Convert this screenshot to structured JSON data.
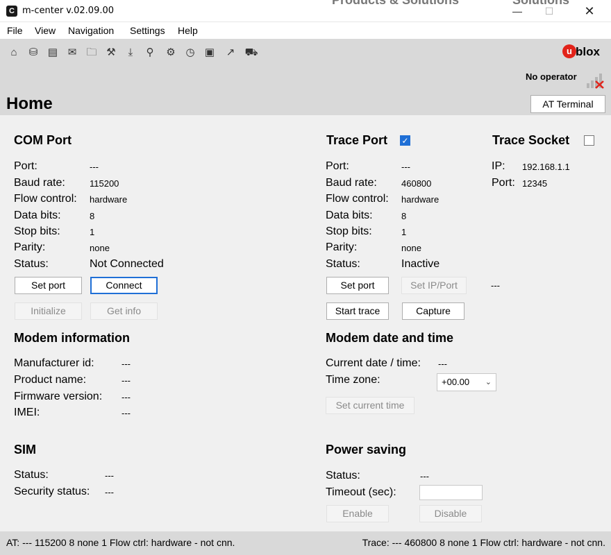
{
  "window": {
    "title": "m-center v.02.09.00",
    "app_icon": "C",
    "behind_text_1": "Products & Solutions",
    "behind_text_2": "Solutions"
  },
  "menu": [
    "File",
    "View",
    "Navigation",
    "Settings",
    "Help"
  ],
  "toolbar_icons": [
    "home-icon",
    "antenna-icon",
    "window-icon",
    "message-icon",
    "folder-icon",
    "tools-icon",
    "download-icon",
    "network-icon",
    "gear-icon",
    "clock-icon",
    "lock-icon",
    "export-icon",
    "car-icon"
  ],
  "brand": {
    "logo_letter": "u",
    "logo_text": "blox",
    "red": "#e2231a"
  },
  "operator": "No operator",
  "page": {
    "title": "Home",
    "at_terminal": "AT Terminal"
  },
  "com_port": {
    "title": "COM Port",
    "labels": [
      "Port:",
      "Baud rate:",
      "Flow control:",
      "Data bits:",
      "Stop bits:",
      "Parity:",
      "Status:"
    ],
    "values": [
      "---",
      "115200",
      "hardware",
      "8",
      "1",
      "none",
      "Not Connected"
    ],
    "buttons": {
      "set_port": "Set port",
      "connect": "Connect",
      "initialize": "Initialize",
      "get_info": "Get info"
    }
  },
  "trace_port": {
    "title": "Trace Port",
    "checked": true,
    "labels": [
      "Port:",
      "Baud rate:",
      "Flow control:",
      "Data bits:",
      "Stop bits:",
      "Parity:",
      "Status:"
    ],
    "values": [
      "---",
      "460800",
      "hardware",
      "8",
      "1",
      "none",
      "Inactive"
    ],
    "buttons": {
      "set_port": "Set port",
      "set_ip_port": "Set IP/Port",
      "start_trace": "Start trace",
      "capture": "Capture"
    },
    "ip_port_value": "---"
  },
  "trace_socket": {
    "title": "Trace Socket",
    "checked": false,
    "ip_label": "IP:",
    "ip_value": "192.168.1.1",
    "port_label": "Port:",
    "port_value": "12345"
  },
  "modem_info": {
    "title": "Modem information",
    "labels": [
      "Manufacturer id:",
      "Product name:",
      "Firmware version:",
      "IMEI:"
    ],
    "values": [
      "---",
      "---",
      "---",
      "---"
    ]
  },
  "modem_time": {
    "title": "Modem date and time",
    "current_label": "Current date / time:",
    "current_value": "---",
    "tz_label": "Time zone:",
    "tz_value": "+00.00",
    "set_time": "Set current time"
  },
  "sim": {
    "title": "SIM",
    "status_label": "Status:",
    "status_value": "---",
    "security_label": "Security status:",
    "security_value": "---"
  },
  "power_saving": {
    "title": "Power saving",
    "status_label": "Status:",
    "status_value": "---",
    "timeout_label": "Timeout (sec):",
    "timeout_value": "",
    "enable": "Enable",
    "disable": "Disable"
  },
  "status_bar": {
    "left": "AT: --- 115200 8 none 1 Flow ctrl: hardware - not cnn.",
    "right": "Trace: --- 460800 8 none 1 Flow ctrl: hardware - not cnn."
  }
}
